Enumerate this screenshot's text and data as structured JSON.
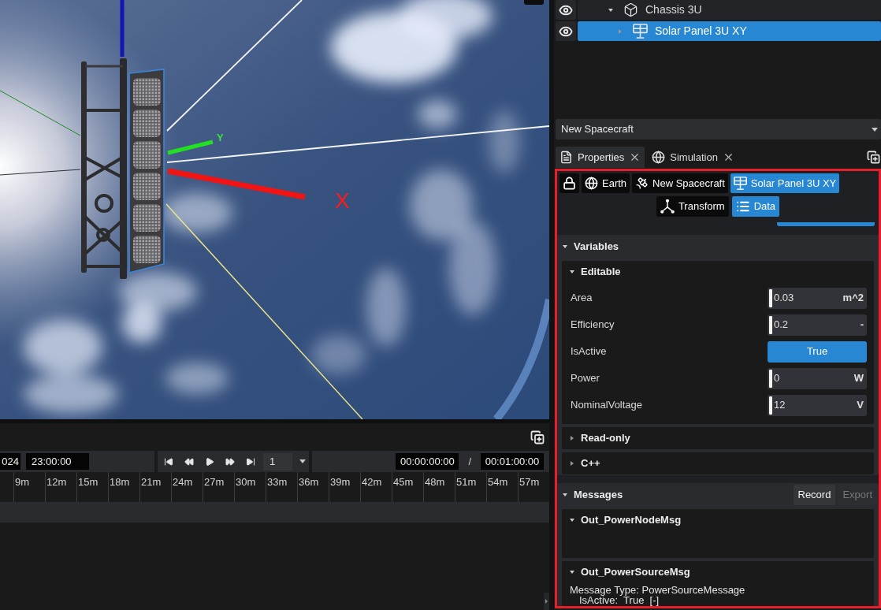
{
  "viewport": {
    "axis_labels": [
      {
        "kind": "y",
        "label": "Y"
      },
      {
        "kind": "x",
        "label": "X"
      }
    ]
  },
  "timeline": {
    "date": "024",
    "time": "23:00:00",
    "speed": "1",
    "current_time": "00:00:00:00",
    "separator": "/",
    "end_time": "00:01:00:00",
    "ruler_labels": [
      "9m",
      "12m",
      "15m",
      "18m",
      "21m",
      "24m",
      "27m",
      "30m",
      "33m",
      "36m",
      "39m",
      "42m",
      "45m",
      "48m",
      "51m",
      "54m",
      "57m"
    ]
  },
  "outliner": {
    "items": [
      {
        "label": "Chassis 3U",
        "kind": "body",
        "expanded": true,
        "selected": false,
        "children": [
          {
            "label": "Solar Panel 3U XY",
            "kind": "panel",
            "expanded": false,
            "selected": true
          }
        ]
      }
    ]
  },
  "object_select": {
    "value": "New Spacecraft"
  },
  "panel_tabs": [
    {
      "label": "Properties",
      "kind": "document",
      "selected": true
    },
    {
      "label": "Simulation",
      "kind": "globe",
      "selected": false
    }
  ],
  "breadcrumb": [
    {
      "kind": "lock",
      "selected": false
    },
    {
      "label": "Earth",
      "kind": "globe",
      "selected": false
    },
    {
      "label": "New Spacecraft",
      "kind": "satellite",
      "selected": false
    },
    {
      "label": "Solar Panel 3U XY",
      "kind": "panel",
      "selected": true
    }
  ],
  "views": [
    {
      "label": "Transform",
      "kind": "axes",
      "selected": false
    },
    {
      "label": "Data",
      "kind": "list",
      "selected": true
    }
  ],
  "variables": {
    "title": "Variables",
    "expanded": true,
    "groups": [
      {
        "title": "Editable",
        "expanded": true,
        "rows": [
          {
            "label": "Area",
            "kind": "number",
            "value": "0.03",
            "unit": "m^2"
          },
          {
            "label": "Efficiency",
            "kind": "number",
            "value": "0.2",
            "unit": "-"
          },
          {
            "label": "IsActive",
            "kind": "toggle",
            "value": "True",
            "on": true
          },
          {
            "label": "Power",
            "kind": "number",
            "value": "0",
            "unit": "W"
          },
          {
            "label": "NominalVoltage",
            "kind": "number",
            "value": "12",
            "unit": "V"
          }
        ]
      },
      {
        "title": "Read-only",
        "expanded": false
      },
      {
        "title": "C++",
        "expanded": false
      }
    ]
  },
  "messages": {
    "title": "Messages",
    "expanded": true,
    "buttons": [
      {
        "label": "Record",
        "disabled": false
      },
      {
        "label": "Export",
        "disabled": true
      }
    ],
    "groups": [
      {
        "title": "Out_PowerNodeMsg",
        "expanded": true
      },
      {
        "title": "Out_PowerSourceMsg",
        "expanded": true,
        "heading": "Message Type: PowerSourceMessage",
        "fields": [
          "IsActive:  True  [-]"
        ]
      }
    ]
  }
}
